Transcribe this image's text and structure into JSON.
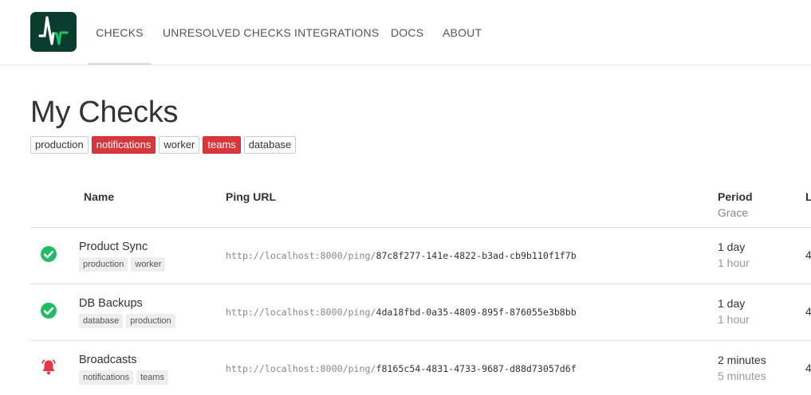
{
  "nav": {
    "items": [
      {
        "label": "CHECKS"
      },
      {
        "label": "UNRESOLVED CHECKS"
      },
      {
        "label": "INTEGRATIONS"
      },
      {
        "label": "DOCS"
      },
      {
        "label": "ABOUT"
      }
    ],
    "active": "CHECKS",
    "logo_icon": "pulse-logo-icon"
  },
  "page": {
    "title": "My Checks"
  },
  "tag_filters": [
    {
      "label": "production",
      "active": false
    },
    {
      "label": "notifications",
      "active": true
    },
    {
      "label": "worker",
      "active": false
    },
    {
      "label": "teams",
      "active": true
    },
    {
      "label": "database",
      "active": false
    }
  ],
  "table": {
    "headers": {
      "name": "Name",
      "ping_url": "Ping URL",
      "period": "Period",
      "grace": "Grace",
      "last_ping": "L"
    },
    "rows": [
      {
        "name": "Product Sync",
        "tags": [
          "production",
          "worker"
        ],
        "status": "up",
        "ping_base": "http://localhost:8000/ping/",
        "ping_code": "87c8f277-141e-4822-b3ad-cb9b110f1f7b",
        "period": "1 day",
        "grace": "1 hour",
        "last": "4"
      },
      {
        "name": "DB Backups",
        "tags": [
          "database",
          "production"
        ],
        "status": "up",
        "ping_base": "http://localhost:8000/ping/",
        "ping_code": "4da18fbd-0a35-4809-895f-876055e3b8bb",
        "period": "1 day",
        "grace": "1 hour",
        "last": "4"
      },
      {
        "name": "Broadcasts",
        "tags": [
          "notifications",
          "teams"
        ],
        "status": "down",
        "ping_base": "http://localhost:8000/ping/",
        "ping_code": "f8165c54-4831-4733-9687-d88d73057d6f",
        "period": "2 minutes",
        "grace": "5 minutes",
        "last": "4"
      }
    ]
  },
  "colors": {
    "up": "#22bc66",
    "down": "#e2374a",
    "tag_active": "#d9363e",
    "logo_bg": "#0b3d2e"
  }
}
